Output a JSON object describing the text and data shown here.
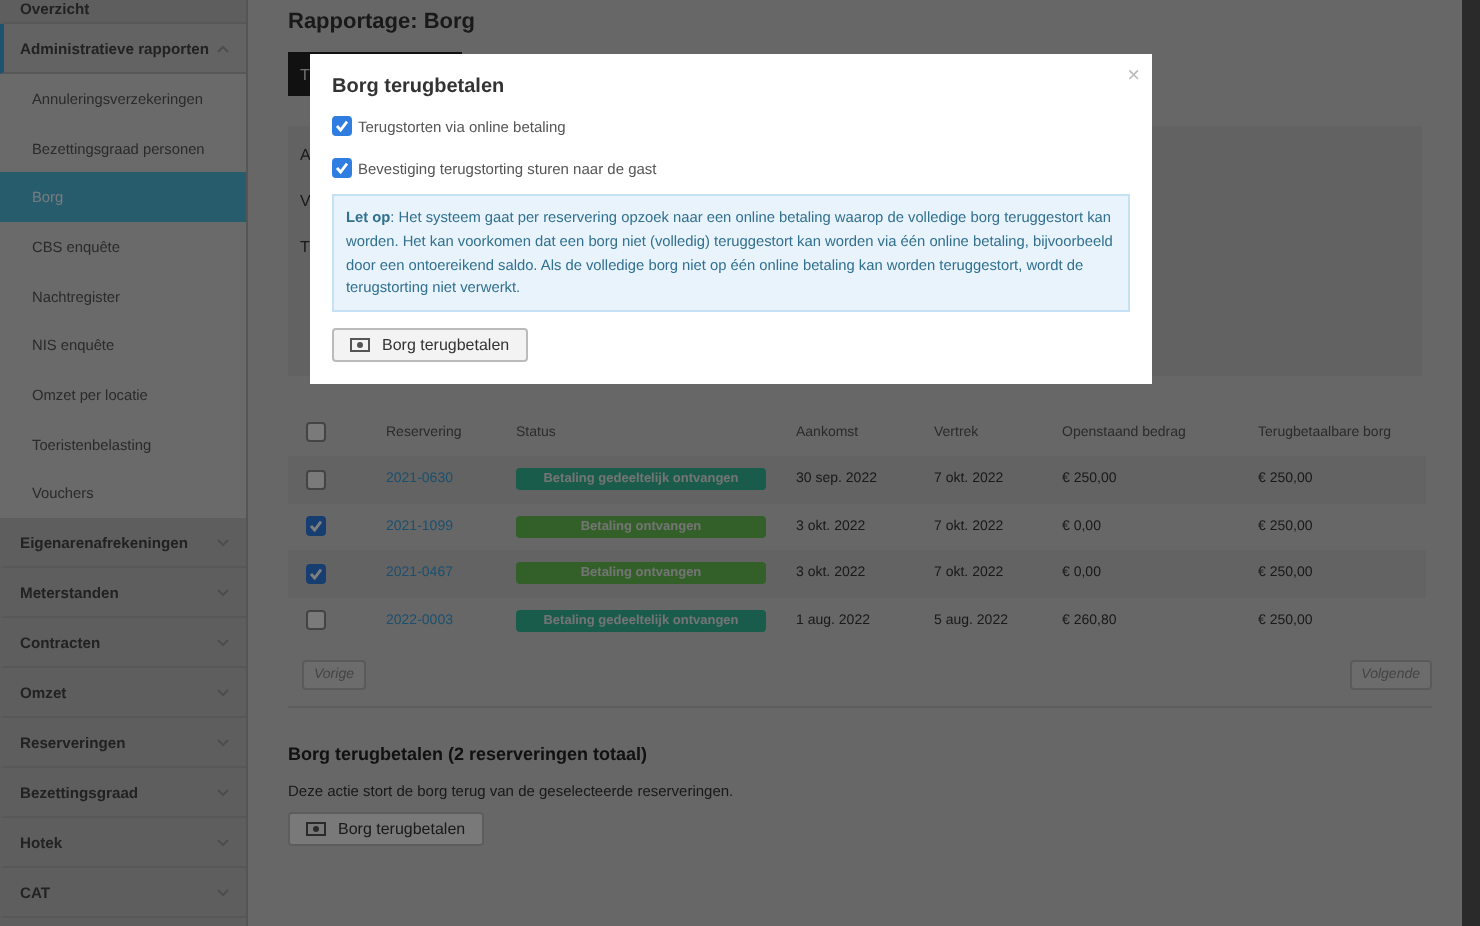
{
  "sidebar": {
    "items": [
      {
        "label": "Overzicht",
        "selected": false
      },
      {
        "label": "Administratieve rapporten",
        "expanded": true,
        "selected": true,
        "children": [
          {
            "label": "Annuleringsverzekeringen",
            "selected": false
          },
          {
            "label": "Bezettingsgraad personen",
            "selected": false
          },
          {
            "label": "Borg",
            "selected": true
          },
          {
            "label": "CBS enquête",
            "selected": false
          },
          {
            "label": "Nachtregister",
            "selected": false
          },
          {
            "label": "NIS enquête",
            "selected": false
          },
          {
            "label": "Omzet per locatie",
            "selected": false
          },
          {
            "label": "Toeristenbelasting",
            "selected": false
          },
          {
            "label": "Vouchers",
            "selected": false
          }
        ]
      },
      {
        "label": "Eigenarenafrekeningen",
        "expanded": false,
        "selected": false
      },
      {
        "label": "Meterstanden",
        "expanded": false,
        "selected": false
      },
      {
        "label": "Contracten",
        "expanded": false,
        "selected": false
      },
      {
        "label": "Omzet",
        "expanded": false,
        "selected": false
      },
      {
        "label": "Reserveringen",
        "expanded": false,
        "selected": false
      },
      {
        "label": "Bezettingsgraad",
        "expanded": false,
        "selected": false
      },
      {
        "label": "Hotek",
        "expanded": false,
        "selected": false
      },
      {
        "label": "CAT",
        "expanded": false,
        "selected": false
      }
    ]
  },
  "page_title": "Rapportage: Borg",
  "toolbar_button": "T",
  "filter_labels": [
    "A",
    "V",
    "T"
  ],
  "table": {
    "all_checked": false,
    "columns": [
      "Reservering",
      "Status",
      "Aankomst",
      "Vertrek",
      "Openstaand bedrag",
      "Terugbetaalbare borg"
    ],
    "rows": [
      {
        "checked": false,
        "reservation": "2021-0630",
        "status": {
          "label": "Betaling gedeeltelijk ontvangen",
          "kind": "partial"
        },
        "arrival": "30 sep. 2022",
        "departure": "7 okt. 2022",
        "outstanding": "€ 250,00",
        "refundable": "€ 250,00"
      },
      {
        "checked": true,
        "reservation": "2021-1099",
        "status": {
          "label": "Betaling ontvangen",
          "kind": "paid"
        },
        "arrival": "3 okt. 2022",
        "departure": "7 okt. 2022",
        "outstanding": "€ 0,00",
        "refundable": "€ 250,00"
      },
      {
        "checked": true,
        "reservation": "2021-0467",
        "status": {
          "label": "Betaling ontvangen",
          "kind": "paid"
        },
        "arrival": "3 okt. 2022",
        "departure": "7 okt. 2022",
        "outstanding": "€ 0,00",
        "refundable": "€ 250,00"
      },
      {
        "checked": false,
        "reservation": "2022-0003",
        "status": {
          "label": "Betaling gedeeltelijk ontvangen",
          "kind": "partial"
        },
        "arrival": "1 aug. 2022",
        "departure": "5 aug. 2022",
        "outstanding": "€ 260,80",
        "refundable": "€ 250,00"
      }
    ]
  },
  "pagination": {
    "previous": "Vorige",
    "next": "Volgende"
  },
  "bulk": {
    "title": "Borg terugbetalen (2 reserveringen totaal)",
    "text": "Deze actie stort de borg terug van de geselecteerde reserveringen.",
    "button": "Borg terugbetalen"
  },
  "modal": {
    "title": "Borg terugbetalen",
    "close": "×",
    "options": [
      {
        "label": "Terugstorten via online betaling",
        "checked": true
      },
      {
        "label": "Bevestiging terugstorting sturen naar de gast",
        "checked": true
      }
    ],
    "notice": "**Let op**: Het systeem gaat per reservering opzoek naar een online betaling waarop de volledige borg teruggestort kan worden. Het kan voorkomen dat een borg niet (volledig) teruggestort kan worden via één online betaling, bijvoorbeeld door een ontoereikend saldo. Als de volledige borg niet op één online betaling kan worden teruggestort, wordt de terugstorting niet verwerkt.",
    "button": "Borg terugbetalen"
  }
}
